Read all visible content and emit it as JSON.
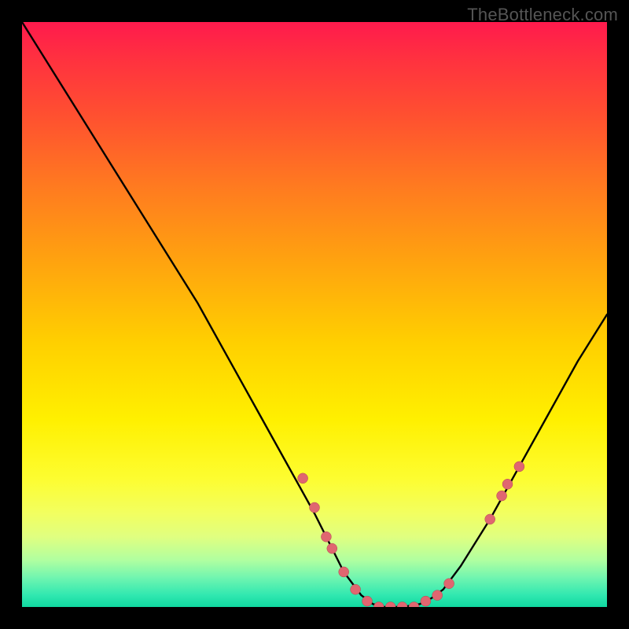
{
  "watermark": "TheBottleneck.com",
  "colors": {
    "curve_stroke": "#000000",
    "dot_fill": "#e06670",
    "dot_stroke": "#b04850"
  },
  "chart_data": {
    "type": "line",
    "title": "",
    "xlabel": "",
    "ylabel": "",
    "xlim": [
      0,
      100
    ],
    "ylim": [
      0,
      100
    ],
    "x": [
      0,
      5,
      10,
      15,
      20,
      25,
      30,
      35,
      40,
      45,
      50,
      52,
      55,
      58,
      60,
      62,
      65,
      68,
      70,
      72,
      75,
      80,
      85,
      90,
      95,
      100
    ],
    "values": [
      100,
      92,
      84,
      76,
      68,
      60,
      52,
      43,
      34,
      25,
      16,
      12,
      6,
      2,
      0.5,
      0,
      0,
      0.5,
      1.5,
      3,
      7,
      15,
      24,
      33,
      42,
      50
    ],
    "scatter_points": {
      "x": [
        48,
        50,
        52,
        53,
        55,
        57,
        59,
        61,
        63,
        65,
        67,
        69,
        71,
        73,
        80,
        82,
        83,
        85
      ],
      "y": [
        22,
        17,
        12,
        10,
        6,
        3,
        1,
        0,
        0,
        0,
        0,
        1,
        2,
        4,
        15,
        19,
        21,
        24
      ]
    }
  }
}
